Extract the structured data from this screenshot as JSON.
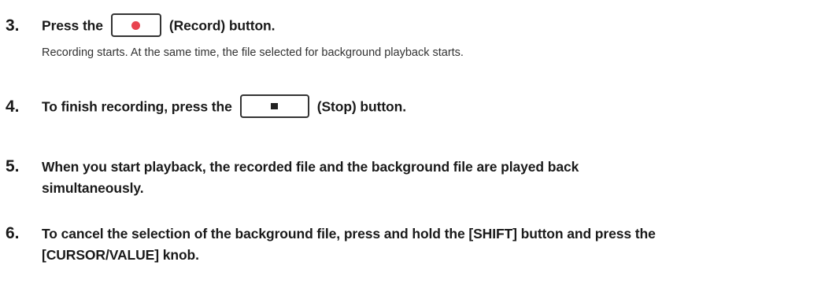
{
  "steps": [
    {
      "number": "3.",
      "before": "Press the",
      "button_icon": "record-icon",
      "after": "(Record) button.",
      "sub": "Recording starts. At the same time, the file selected for background playback starts."
    },
    {
      "number": "4.",
      "before": "To finish recording, press the",
      "button_icon": "stop-icon",
      "after": "(Stop) button."
    },
    {
      "number": "5.",
      "line1": "When you start playback, the recorded file and the background file are played back",
      "line2": "simultaneously."
    },
    {
      "number": "6.",
      "line1": "To cancel the selection of the background file, press and hold the [SHIFT] button and press the",
      "line2": "[CURSOR/VALUE] knob."
    }
  ],
  "colors": {
    "record_dot": "#e8434f",
    "text": "#1a1a1a"
  }
}
